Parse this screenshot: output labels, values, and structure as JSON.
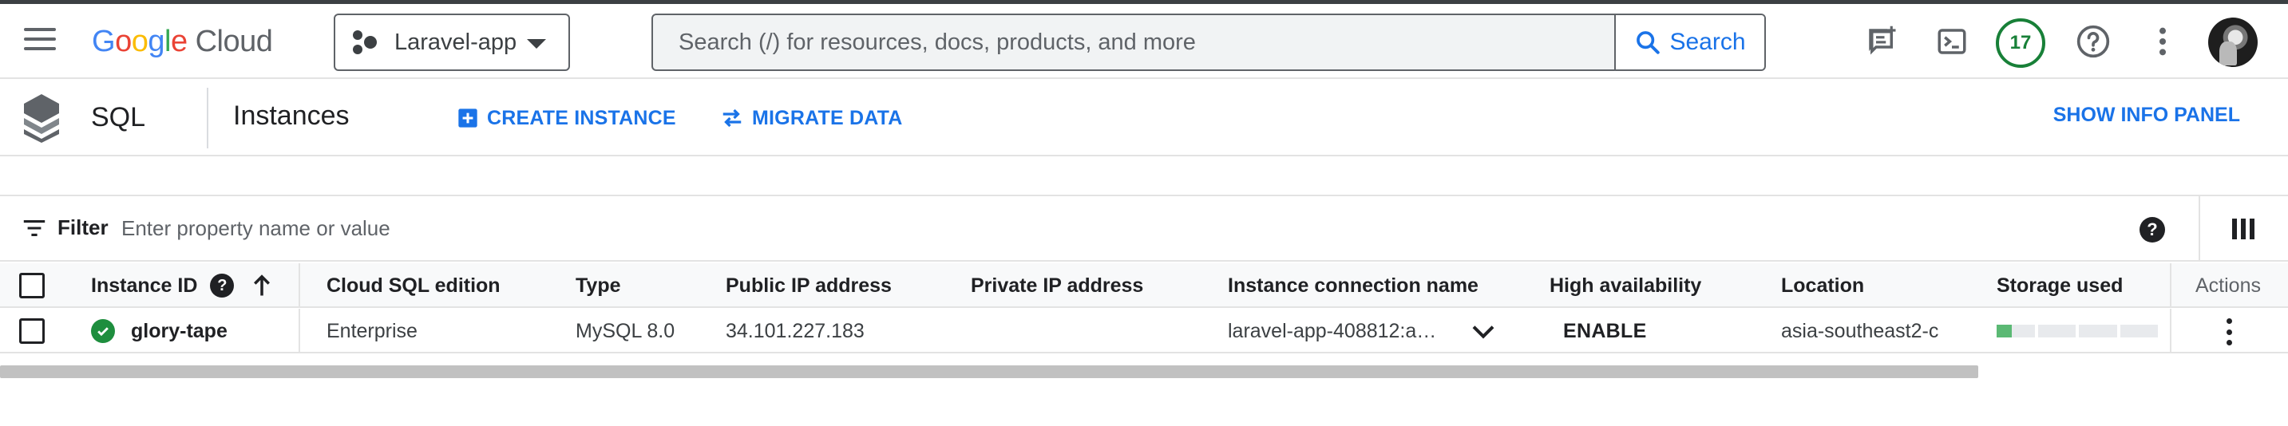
{
  "header": {
    "logo": {
      "google": [
        "G",
        "o",
        "o",
        "g",
        "l",
        "e"
      ],
      "cloud": "Cloud"
    },
    "project": "Laravel-app",
    "search": {
      "placeholder": "Search (/) for resources, docs, products, and more",
      "button_label": "Search"
    },
    "notifications_count": "17",
    "icons": [
      "menu-icon",
      "chat-feedback-icon",
      "cloud-shell-icon",
      "help-icon",
      "more-vert-icon"
    ]
  },
  "subheader": {
    "product": "SQL",
    "page_title": "Instances",
    "actions": [
      {
        "label": "CREATE INSTANCE",
        "icon": "add-box-icon"
      },
      {
        "label": "MIGRATE DATA",
        "icon": "swap-arrows-icon"
      }
    ],
    "info_panel_label": "SHOW INFO PANEL"
  },
  "filter": {
    "label": "Filter",
    "placeholder": "Enter property name or value",
    "help": "?"
  },
  "table": {
    "columns": [
      "Instance ID",
      "Cloud SQL edition",
      "Type",
      "Public IP address",
      "Private IP address",
      "Instance connection name",
      "High availability",
      "Location",
      "Storage used",
      "Actions"
    ],
    "help": "?",
    "rows": [
      {
        "instance_id": "glory-tape",
        "status": "running",
        "edition": "Enterprise",
        "type": "MySQL 8.0",
        "public_ip": "34.101.227.183",
        "private_ip": "",
        "connection_name": "laravel-app-408812:a…",
        "high_availability": "ENABLE",
        "location": "asia-southeast2-c",
        "storage_used_fraction": 0.1
      }
    ]
  },
  "colors": {
    "accent": "#1a73e8",
    "success": "#1e8e3e",
    "text": "#202124",
    "muted": "#5f6368"
  }
}
